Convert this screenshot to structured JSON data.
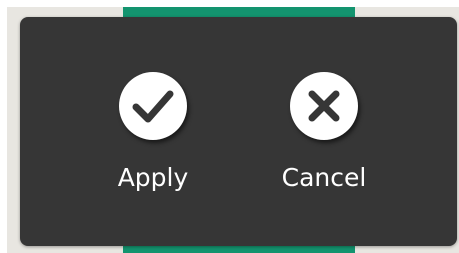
{
  "colors": {
    "panel": "#363636",
    "accent": "#13946f",
    "backdrop": "#e8e6e1",
    "icon_circle": "#ffffff",
    "icon_glyph": "#363636",
    "label_text": "#ffffff"
  },
  "actions": [
    {
      "label": "Apply",
      "icon": "checkmark-icon"
    },
    {
      "label": "Cancel",
      "icon": "close-icon"
    }
  ]
}
